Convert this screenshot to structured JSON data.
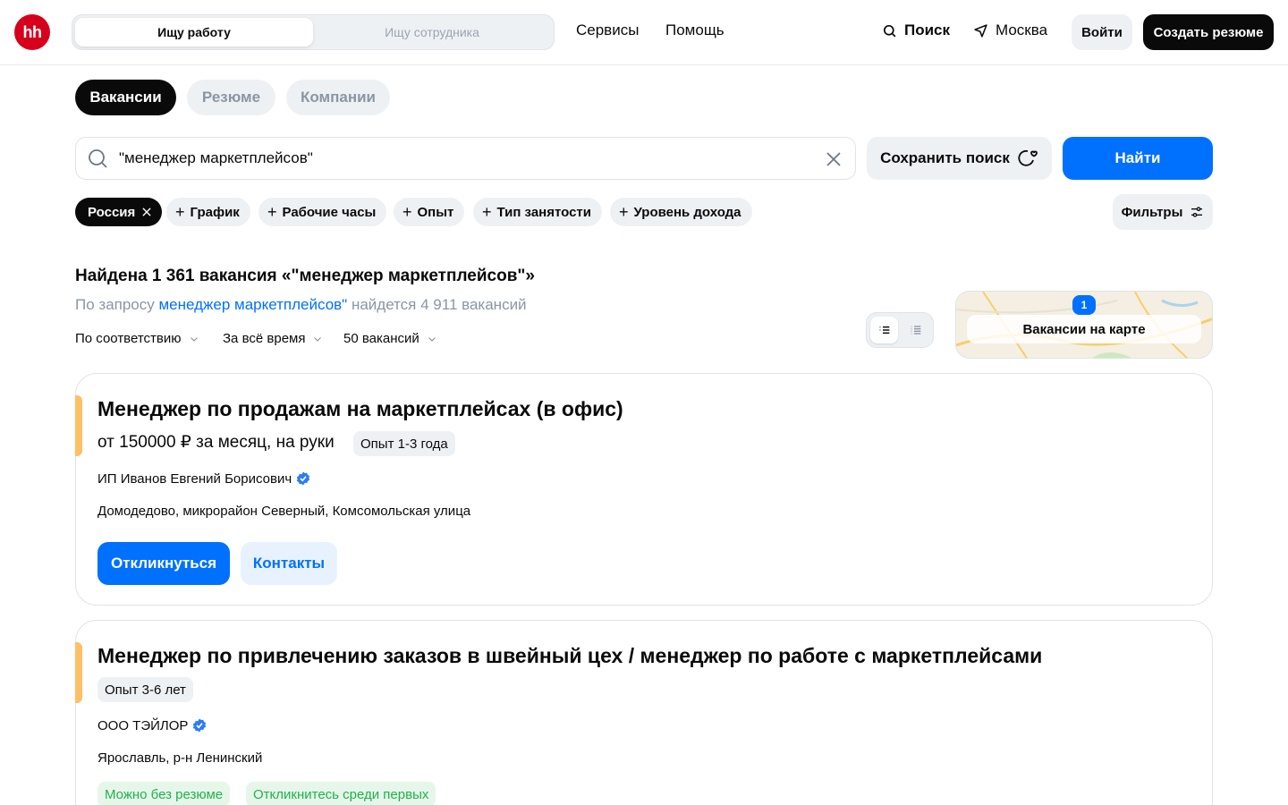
{
  "header": {
    "logo_text": "hh",
    "mode": {
      "job_seeker": "Ищу работу",
      "employer": "Ищу сотрудника"
    },
    "nav": {
      "services": "Сервисы",
      "help": "Помощь",
      "search": "Поиск",
      "city": "Москва"
    },
    "login": "Войти",
    "create_resume": "Создать резюме"
  },
  "tabs": [
    "Вакансии",
    "Резюме",
    "Компании"
  ],
  "search": {
    "value": "\"менеджер маркетплейсов\"",
    "save_label": "Сохранить поиск",
    "find_label": "Найти"
  },
  "chips": {
    "region": "Россия",
    "schedule": "График",
    "hours": "Рабочие часы",
    "experience": "Опыт",
    "employment": "Тип занятости",
    "income": "Уровень дохода",
    "filters": "Фильтры"
  },
  "results": {
    "found": "Найдена 1 361 вакансия «\"менеджер маркетплейсов\"»",
    "suggest_prefix": "По запросу ",
    "suggest_link": "менеджер маркетплейсов\"",
    "suggest_suffix": " найдется 4 911 вакансий",
    "sort_relevance": "По соответствию",
    "sort_time": "За всё время",
    "sort_count": "50 вакансий",
    "map_label": "Вакансии на карте",
    "map_pin": "1"
  },
  "vacancies": [
    {
      "title": "Менеджер по продажам на маркетплейсах (в офис)",
      "salary": "от 150000 ₽ за месяц, на руки",
      "experience": "Опыт 1-3 года",
      "company": "ИП Иванов Евгений Борисович",
      "address": "Домодедово, микрорайон Северный, Комсомольская улица",
      "apply": "Откликнуться",
      "contacts": "Контакты"
    },
    {
      "title": "Менеджер по привлечению заказов в швейный цех / менеджер по работе с маркетплейсами",
      "experience": "Опыт 3-6 лет",
      "company": "ООО ТЭЙЛОР",
      "address": "Ярославль, р-н Ленинский",
      "tag1": "Можно без резюме",
      "tag2": "Откликнитесь среди первых"
    }
  ],
  "colors": {
    "brand": "#d6001c",
    "accent_blue": "#0070ff",
    "highlight": "#ffbf66",
    "success": "#1fb24b"
  }
}
